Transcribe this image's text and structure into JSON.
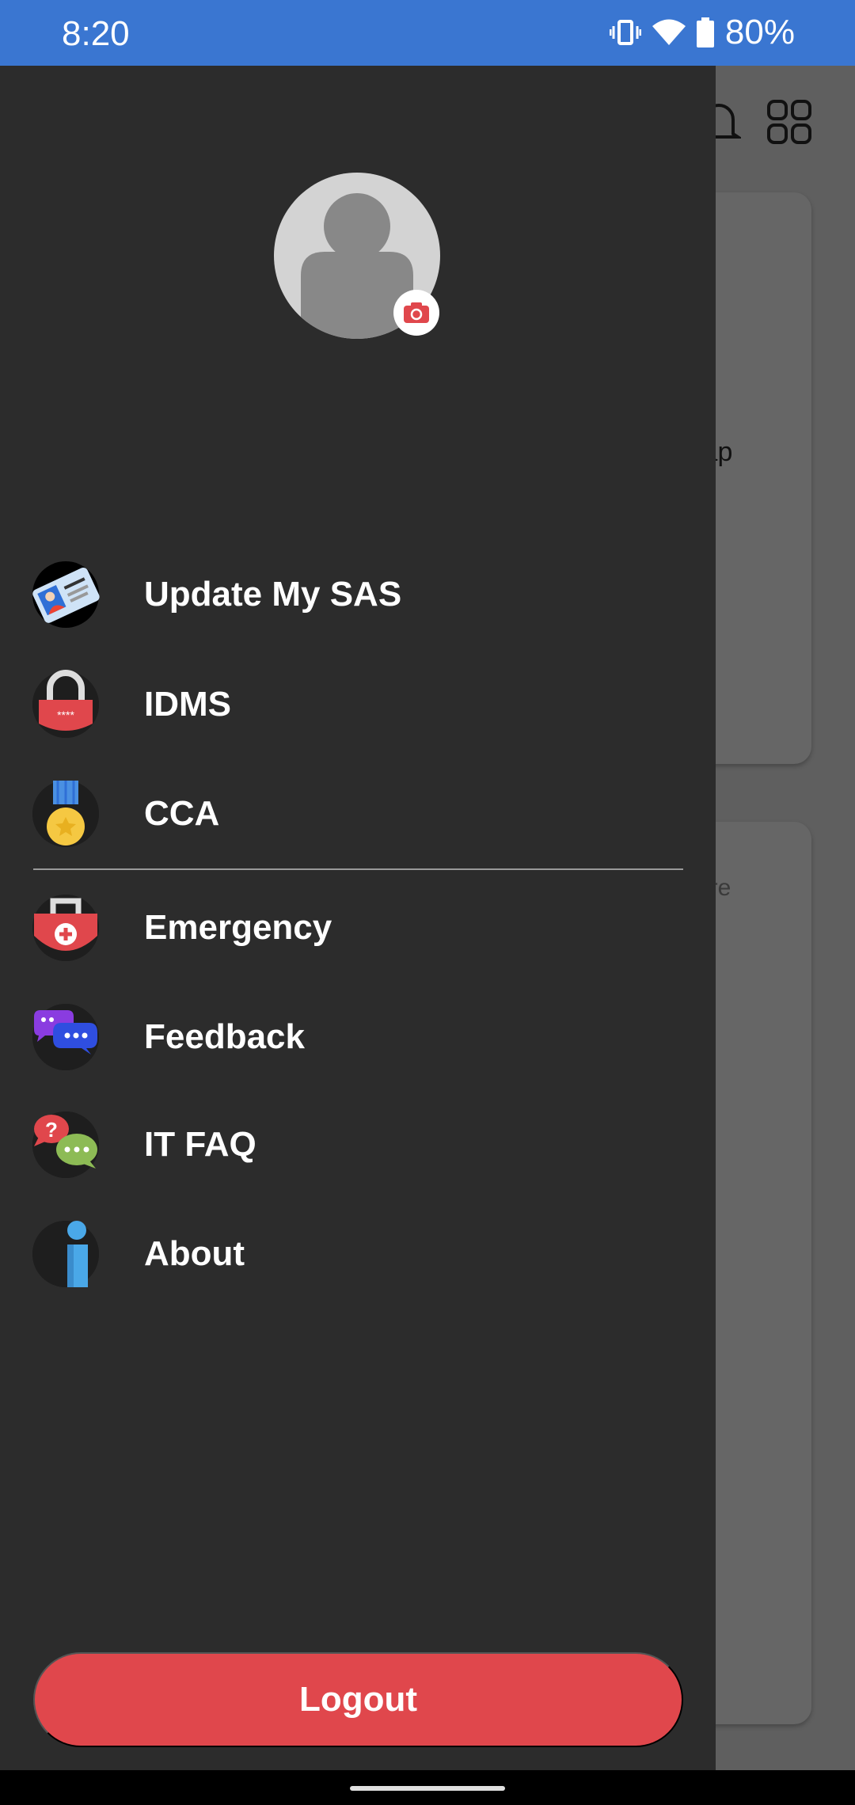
{
  "status_bar": {
    "time": "8:20",
    "battery": "80%",
    "icons": [
      "vibrate-icon",
      "wifi-icon",
      "battery-icon"
    ]
  },
  "background": {
    "partial_text_1": "lap",
    "partial_text_2": "ore",
    "icons": [
      "bell-icon",
      "grid-icon"
    ]
  },
  "drawer": {
    "avatar_icon": "person-icon",
    "camera_icon": "camera-icon",
    "items": [
      {
        "label": "Update My SAS",
        "icon": "id-card-icon"
      },
      {
        "label": "IDMS",
        "icon": "padlock-icon"
      },
      {
        "label": "CCA",
        "icon": "medal-icon"
      },
      {
        "label": "Emergency",
        "icon": "first-aid-icon"
      },
      {
        "label": "Feedback",
        "icon": "chat-bubbles-icon"
      },
      {
        "label": "IT FAQ",
        "icon": "faq-bubbles-icon"
      },
      {
        "label": "About",
        "icon": "info-icon"
      }
    ],
    "logout_label": "Logout"
  },
  "colors": {
    "status_bar": "#3a76d1",
    "drawer": "#2c2c2c",
    "logout": "#e0474c"
  }
}
